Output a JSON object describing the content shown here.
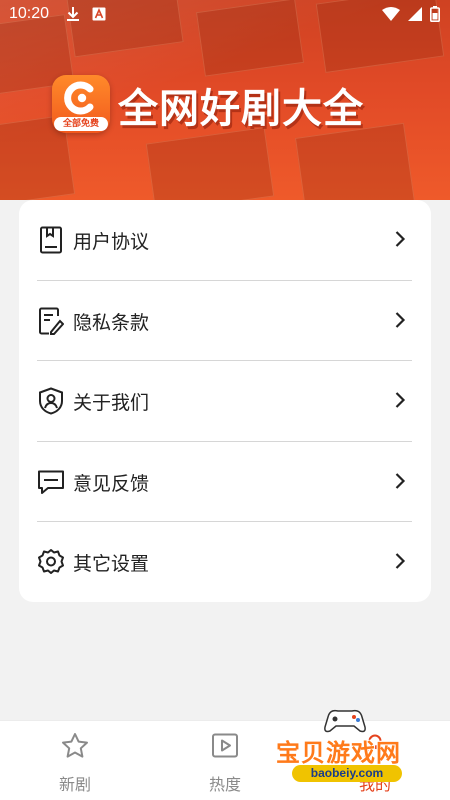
{
  "status_bar": {
    "time": "10:20",
    "left_icons": [
      "download-icon",
      "a-icon"
    ],
    "right_icons": [
      "wifi-icon",
      "signal-icon",
      "battery-icon"
    ]
  },
  "header": {
    "logo_badge": "全部免费",
    "app_title": "全网好剧大全"
  },
  "menu": {
    "items": [
      {
        "label": "用户协议",
        "icon": "document-icon"
      },
      {
        "label": "隐私条款",
        "icon": "edit-document-icon"
      },
      {
        "label": "关于我们",
        "icon": "shield-user-icon"
      },
      {
        "label": "意见反馈",
        "icon": "message-icon"
      },
      {
        "label": "其它设置",
        "icon": "gear-icon"
      }
    ]
  },
  "bottom_nav": {
    "items": [
      {
        "label": "新剧",
        "icon": "star-icon",
        "active": false
      },
      {
        "label": "热度",
        "icon": "play-icon",
        "active": false
      },
      {
        "label": "我的",
        "icon": "user-icon",
        "active": true
      }
    ]
  },
  "watermark": {
    "text": "宝贝游戏网",
    "url": "baobeiy.com"
  },
  "colors": {
    "brand": "#e5421c",
    "banner": "#e14a27",
    "card": "#ffffff",
    "background": "#f2f2f2"
  }
}
